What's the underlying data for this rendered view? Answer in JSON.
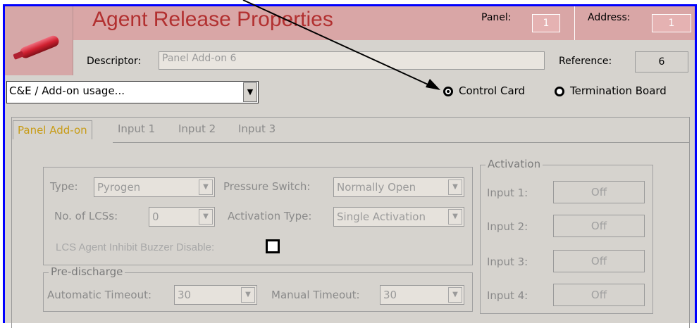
{
  "header": {
    "title": "Agent Release Properties",
    "panel_label": "Panel:",
    "panel_value": "1",
    "address_label": "Address:",
    "address_value": "1",
    "descriptor_label": "Descriptor:",
    "descriptor_value": "Panel Add-on 6",
    "reference_label": "Reference:",
    "reference_value": "6"
  },
  "usage_dropdown": {
    "value": "C&E / Add-on usage..."
  },
  "card_type": {
    "options": [
      "Control Card",
      "Termination Board"
    ],
    "selected": "Control Card"
  },
  "tabs": [
    {
      "label": "Panel Add-on",
      "active": true
    },
    {
      "label": "Input 1"
    },
    {
      "label": "Input 2"
    },
    {
      "label": "Input 3"
    }
  ],
  "panel_addon": {
    "type_label": "Type:",
    "type_value": "Pyrogen",
    "pressure_switch_label": "Pressure Switch:",
    "pressure_switch_value": "Normally Open",
    "lcs_count_label": "No. of LCSs:",
    "lcs_count_value": "0",
    "activation_type_label": "Activation Type:",
    "activation_type_value": "Single Activation",
    "inhibit_label": "LCS Agent Inhibit Buzzer Disable:",
    "prediv_title": "Pre-discharge",
    "auto_timeout_label": "Automatic Timeout:",
    "auto_timeout_value": "30",
    "manual_timeout_label": "Manual Timeout:",
    "manual_timeout_value": "30"
  },
  "activation": {
    "title": "Activation",
    "inputs": [
      {
        "label": "Input 1:",
        "value": "Off"
      },
      {
        "label": "Input 2:",
        "value": "Off"
      },
      {
        "label": "Input 3:",
        "value": "Off"
      },
      {
        "label": "Input 4:",
        "value": "Off"
      }
    ]
  },
  "colors": {
    "header_bg": "#d9a6a6",
    "title": "#b23030",
    "active_tab": "#c89c18",
    "frame_border": "#0000ff"
  }
}
